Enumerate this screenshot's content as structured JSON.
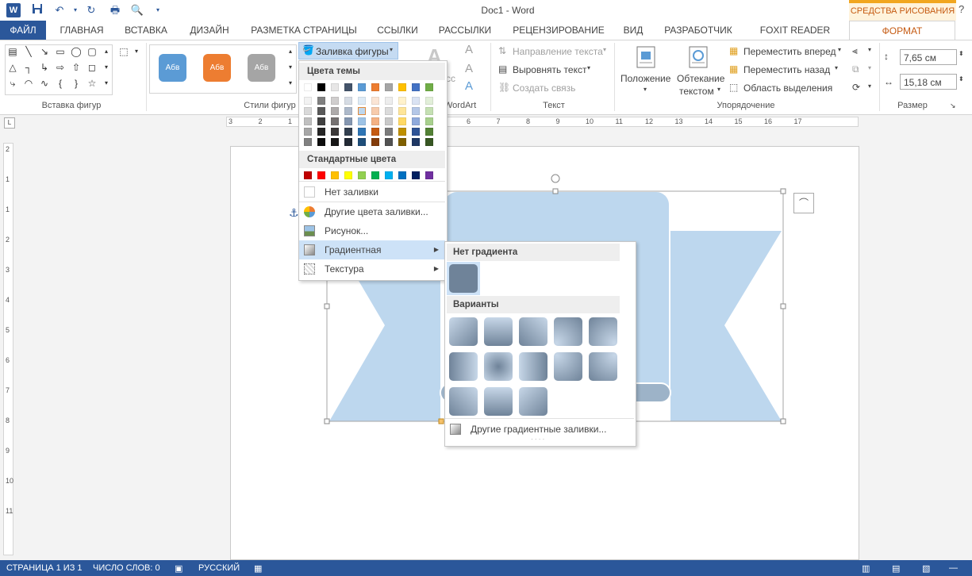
{
  "window": {
    "title": "Doc1 - Word",
    "context_banner": "СРЕДСТВА РИСОВАНИЯ",
    "controls": [
      "?",
      "−",
      "❐",
      "✕"
    ]
  },
  "tabs": [
    "ФАЙЛ",
    "ГЛАВНАЯ",
    "ВСТАВКА",
    "ДИЗАЙН",
    "РАЗМЕТКА СТРАНИЦЫ",
    "ССЫЛКИ",
    "РАССЫЛКИ",
    "РЕЦЕНЗИРОВАНИЕ",
    "ВИД",
    "РАЗРАБОТЧИК",
    "FOXIT READER PDF",
    "ФОРМАТ"
  ],
  "ribbon": {
    "groups": {
      "insert_shapes": "Вставка фигур",
      "shape_styles": "Стили фигур",
      "wordart": "WordArt",
      "text": "Текст",
      "arrange": "Упорядочение",
      "size": "Размер"
    },
    "style_samples": [
      "Абв",
      "Абв",
      "Абв"
    ],
    "fill_button": "Заливка фигуры",
    "text_direction": "Направление текста",
    "align_text": "Выровнять текст",
    "create_link": "Создать связь",
    "position": "Положение",
    "wrap_text": [
      "Обтекание",
      "текстом"
    ],
    "bring_forward": "Переместить вперед",
    "send_backward": "Переместить назад",
    "selection_pane": "Область выделения",
    "height": "7,65 см",
    "width": "15,18 см",
    "frag_cc": "сс",
    "frag_a": "А"
  },
  "fill_menu": {
    "theme_colors_header": "Цвета темы",
    "theme_top": [
      "#ffffff",
      "#000000",
      "#e7e6e6",
      "#44546a",
      "#5b9bd5",
      "#ed7d31",
      "#a5a5a5",
      "#ffc000",
      "#4472c4",
      "#70ad47"
    ],
    "theme_shades": [
      [
        "#f2f2f2",
        "#d9d9d9",
        "#bfbfbf",
        "#a6a6a6",
        "#808080"
      ],
      [
        "#808080",
        "#595959",
        "#404040",
        "#262626",
        "#0d0d0d"
      ],
      [
        "#d0cece",
        "#aeabab",
        "#757171",
        "#3b3838",
        "#171616"
      ],
      [
        "#d6dce4",
        "#adb9ca",
        "#8496b0",
        "#323f4f",
        "#222a35"
      ],
      [
        "#deebf6",
        "#bdd7ee",
        "#9dc3e6",
        "#2e75b5",
        "#1f4e79"
      ],
      [
        "#fbe5d5",
        "#f7cbac",
        "#f4b183",
        "#c55a11",
        "#833c0b"
      ],
      [
        "#ededed",
        "#dbdbdb",
        "#c9c9c9",
        "#7b7b7b",
        "#525252"
      ],
      [
        "#fff2cc",
        "#fee599",
        "#ffd965",
        "#bf9000",
        "#7f6000"
      ],
      [
        "#dae3f3",
        "#b4c7e7",
        "#8faadc",
        "#2f5496",
        "#1f3864"
      ],
      [
        "#e2efd9",
        "#c5e0b3",
        "#a8d08d",
        "#538135",
        "#375623"
      ]
    ],
    "standard_header": "Стандартные цвета",
    "standard": [
      "#c00000",
      "#ff0000",
      "#ffc000",
      "#ffff00",
      "#92d050",
      "#00b050",
      "#00b0f0",
      "#0070c0",
      "#002060",
      "#7030a0"
    ],
    "no_fill": "Нет заливки",
    "more_colors": "Другие цвета заливки...",
    "picture": "Рисунок...",
    "gradient": "Градиентная",
    "texture": "Текстура"
  },
  "gradient_menu": {
    "no_gradient_header": "Нет градиента",
    "variants_header": "Варианты",
    "more": "Другие градиентные заливки..."
  },
  "ruler": {
    "h": [
      "3",
      "2",
      "1",
      "1",
      "2",
      "3",
      "4",
      "5",
      "6",
      "7",
      "8",
      "9",
      "10",
      "11",
      "12",
      "13",
      "14",
      "15",
      "16",
      "17"
    ],
    "v": [
      "2",
      "1",
      "1",
      "2",
      "3",
      "4",
      "5",
      "6",
      "7",
      "8",
      "9",
      "10",
      "11"
    ]
  },
  "status": {
    "page": "СТРАНИЦА 1 ИЗ 1",
    "words": "ЧИСЛО СЛОВ: 0",
    "lang": "РУССКИЙ"
  },
  "colors": {
    "accent": "#2b579a",
    "context": "#c55a11",
    "shape_fill": "#bdd7ee",
    "shape_dark": "#9db3c8"
  }
}
